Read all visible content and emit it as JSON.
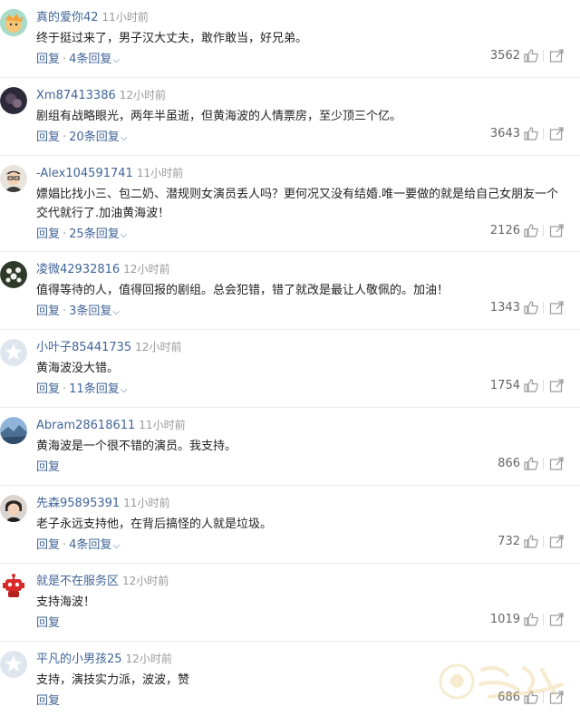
{
  "comments": [
    {
      "user": "真的爱你42",
      "time": "11小时前",
      "text": "终于挺过来了，男子汉大丈夫，敢作敢当，好兄弟。",
      "reply_label": "回复",
      "dot": "·",
      "replies": "4条回复",
      "likes": "3562"
    },
    {
      "user": "Xm87413386",
      "time": "12小时前",
      "text": "剧组有战略眼光，两年半虽逝，但黄海波的人情票房，至少顶三个亿。",
      "reply_label": "回复",
      "dot": "·",
      "replies": "20条回复",
      "likes": "3643"
    },
    {
      "user": "-Alex104591741",
      "time": "11小时前",
      "text": "嫖娼比找小三、包二奶、潜规则女演员丢人吗？更何况又没有结婚.唯一要做的就是给自己女朋友一个交代就行了.加油黄海波！",
      "reply_label": "回复",
      "dot": "·",
      "replies": "25条回复",
      "likes": "2126"
    },
    {
      "user": "凌微42932816",
      "time": "12小时前",
      "text": "值得等待的人，值得回报的剧组。总会犯错，错了就改是最让人敬佩的。加油！",
      "reply_label": "回复",
      "dot": "·",
      "replies": "3条回复",
      "likes": "1343"
    },
    {
      "user": "小叶子85441735",
      "time": "12小时前",
      "text": "黄海波没大错。",
      "reply_label": "回复",
      "dot": "·",
      "replies": "11条回复",
      "likes": "1754"
    },
    {
      "user": "Abram28618611",
      "time": "11小时前",
      "text": "黄海波是一个很不错的演员。我支持。",
      "reply_label": "回复",
      "dot": "",
      "replies": "",
      "likes": "866"
    },
    {
      "user": "先森95895391",
      "time": "11小时前",
      "text": "老子永远支持他，在背后搞怪的人就是垃圾。",
      "reply_label": "回复",
      "dot": "·",
      "replies": "4条回复",
      "likes": "732"
    },
    {
      "user": "就是不在服务区",
      "time": "12小时前",
      "text": "支持海波！",
      "reply_label": "回复",
      "dot": "",
      "replies": "",
      "likes": "1019"
    },
    {
      "user": "平凡的小男孩25",
      "time": "12小时前",
      "text": "支持，演技实力派，波波，赞",
      "reply_label": "回复",
      "dot": "",
      "replies": "",
      "likes": "686"
    }
  ],
  "avatars": [
    "face-avatar",
    "dark-avatar",
    "glasses-avatar",
    "flower-avatar",
    "default-star-avatar",
    "landscape-avatar",
    "portrait-avatar",
    "red-robot-avatar",
    "default-star-avatar"
  ],
  "colors": {
    "username": "#406599",
    "time": "#999999",
    "text": "#222222",
    "link": "#406599",
    "divider": "#eeeeee"
  },
  "icons": {
    "like": "thumbs-up-icon",
    "share": "share-icon",
    "expand": "chevron-down-icon"
  }
}
